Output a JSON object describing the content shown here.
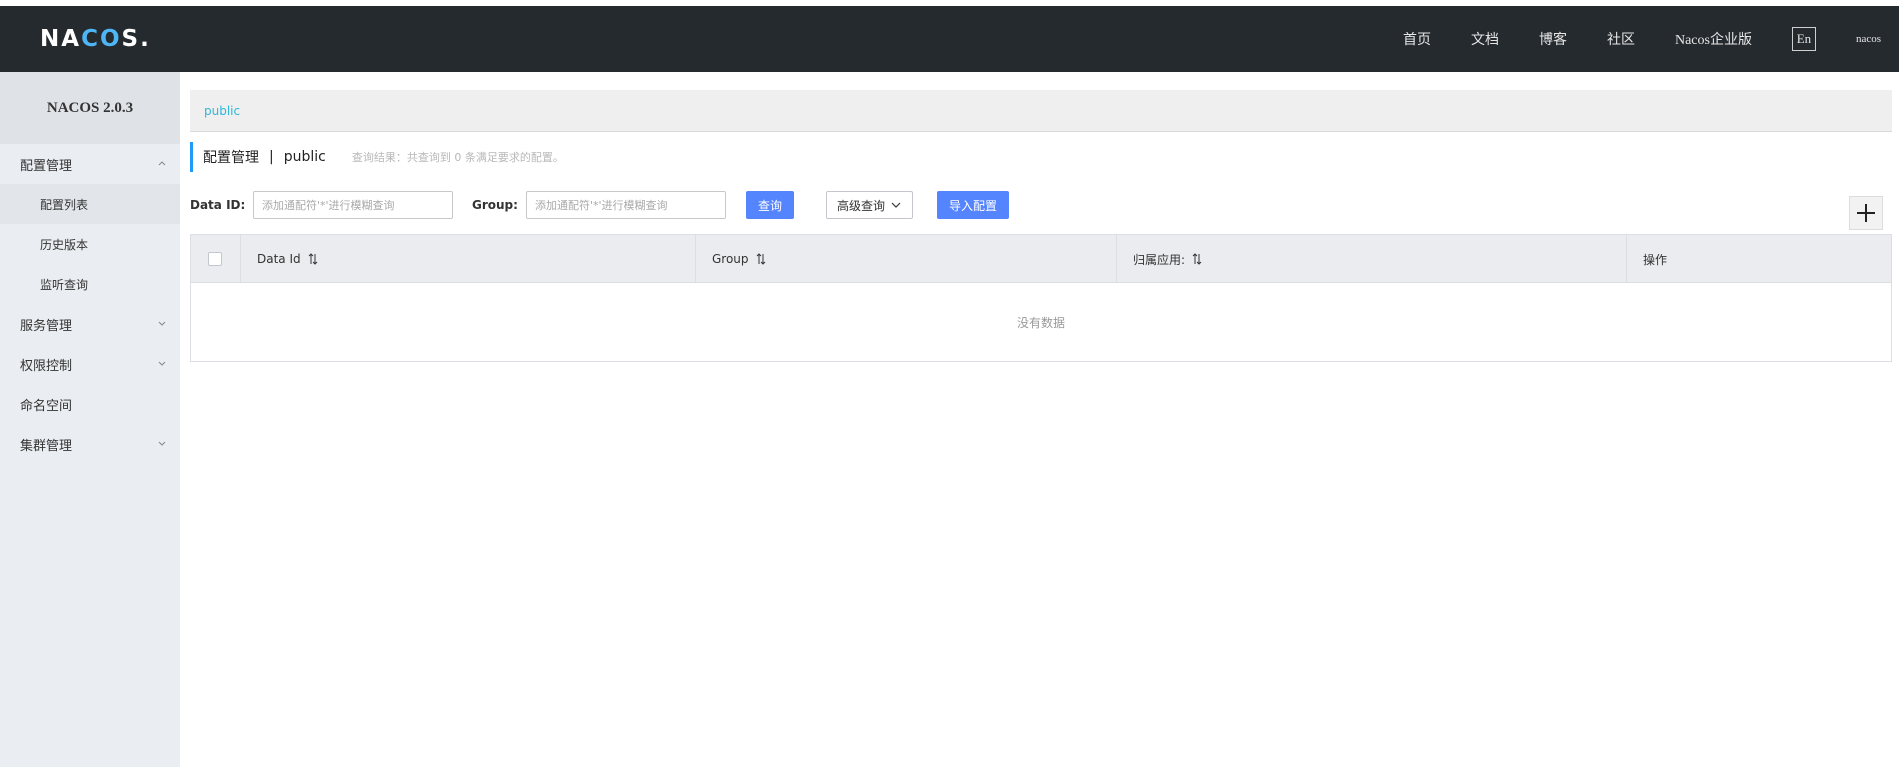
{
  "header": {
    "logo_text_a": "NA",
    "logo_text_b": "CO",
    "logo_text_c": "S",
    "logo_dot": ".",
    "nav": [
      "首页",
      "文档",
      "博客",
      "社区",
      "Nacos企业版"
    ],
    "lang": "En",
    "user": "nacos"
  },
  "sidebar": {
    "title": "NACOS 2.0.3",
    "groups": [
      {
        "label": "配置管理",
        "expanded": true,
        "items": [
          "配置列表",
          "历史版本",
          "监听查询"
        ]
      },
      {
        "label": "服务管理",
        "expanded": false
      },
      {
        "label": "权限控制",
        "expanded": false
      },
      {
        "label": "命名空间"
      },
      {
        "label": "集群管理",
        "expanded": false
      }
    ]
  },
  "namespace_bar": {
    "active": "public"
  },
  "page_head": {
    "title": "配置管理",
    "sep": "|",
    "namespace": "public",
    "result": "查询结果：共查询到 0 条满足要求的配置。"
  },
  "search": {
    "data_id_label": "Data ID:",
    "data_id_placeholder": "添加通配符'*'进行模糊查询",
    "group_label": "Group:",
    "group_placeholder": "添加通配符'*'进行模糊查询",
    "query_btn": "查询",
    "advanced_btn": "高级查询",
    "import_btn": "导入配置"
  },
  "table": {
    "columns": [
      "Data Id",
      "Group",
      "归属应用:",
      "操作"
    ],
    "empty_text": "没有数据"
  },
  "colors": {
    "topbar": "#252a2f",
    "primary": "#5584ff",
    "link": "#2db7d8",
    "accent_bar": "#209bfa"
  }
}
